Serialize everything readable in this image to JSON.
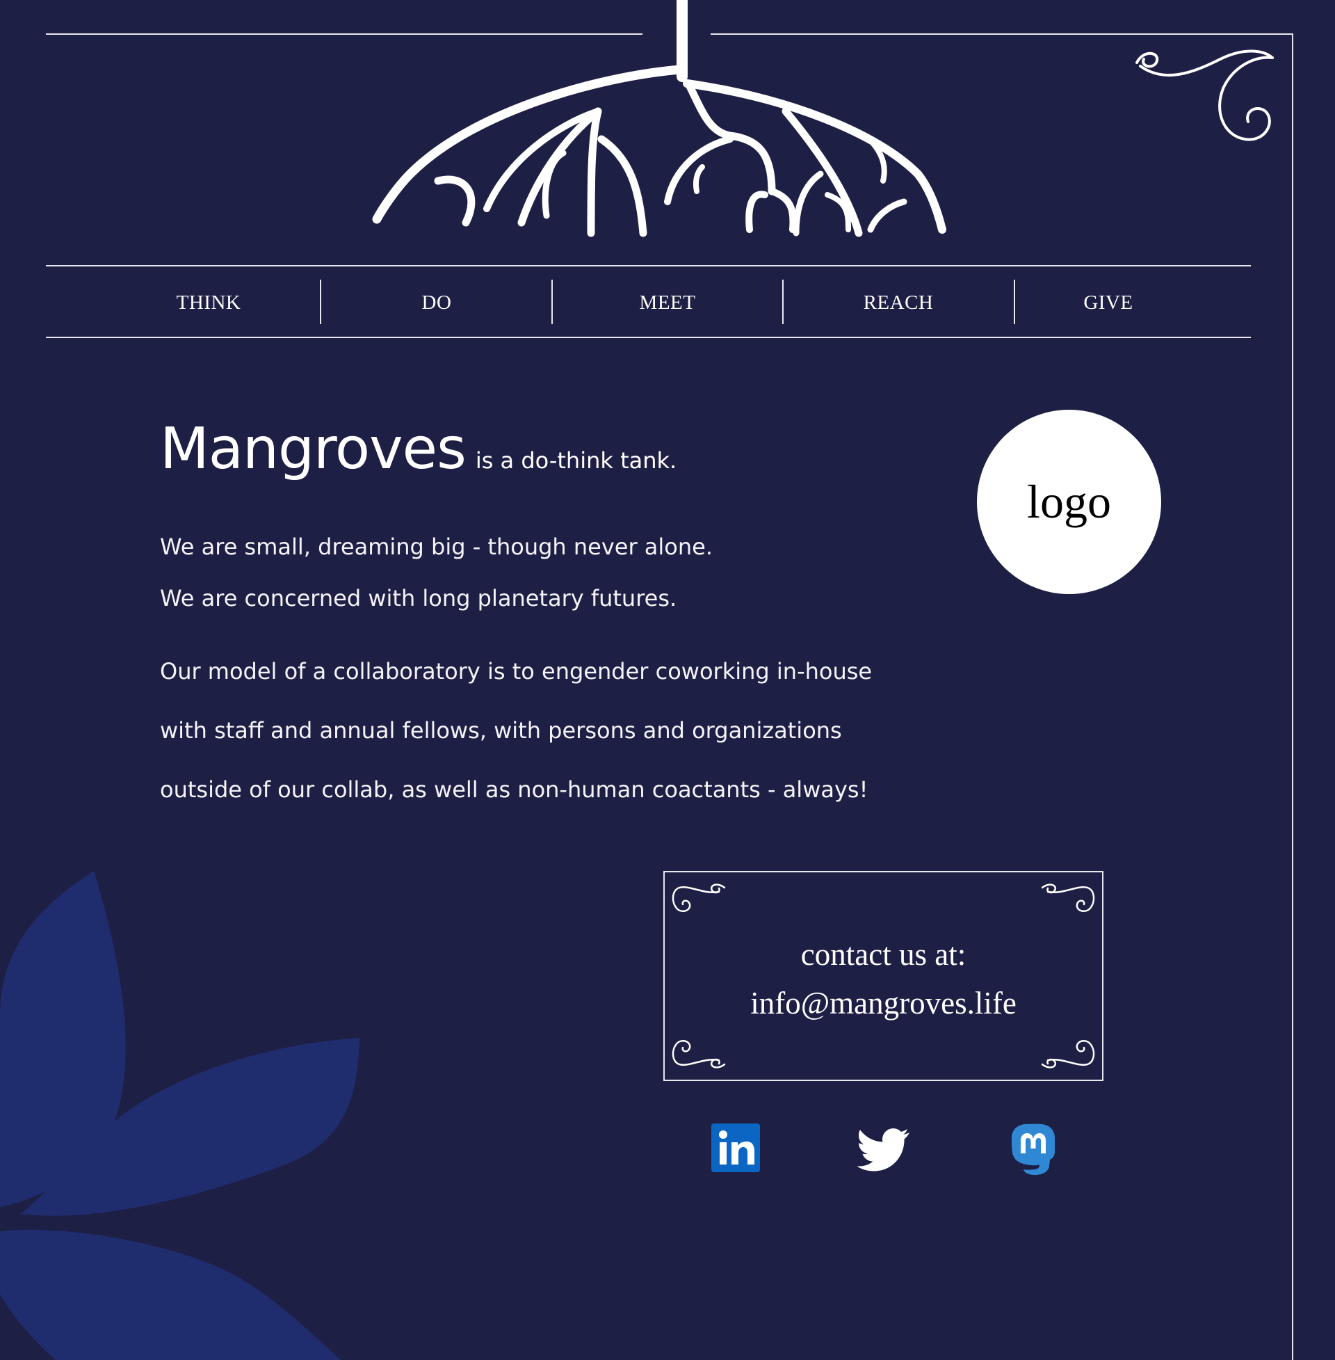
{
  "nav": {
    "items": [
      {
        "label": "THINK"
      },
      {
        "label": "DO"
      },
      {
        "label": "MEET"
      },
      {
        "label": "REACH"
      },
      {
        "label": "GIVE"
      }
    ]
  },
  "intro": {
    "name": "Mangroves",
    "tagline": "is a do-think tank.",
    "line1": "We are small, dreaming big - though never alone.",
    "line2": "We are concerned with long planetary futures.",
    "model_lines": [
      "Our model of a collaboratory is to engender coworking in-house",
      "with staff and annual fellows, with persons and organizations",
      "outside of our collab, as well as non-human coactants - always!"
    ]
  },
  "logo": {
    "text": "logo"
  },
  "contact": {
    "heading": "contact us at:",
    "email": "info@mangroves.life"
  },
  "social": {
    "linkedin_icon": "linkedin-icon",
    "twitter_icon": "twitter-icon",
    "mastodon_icon": "mastodon-icon"
  },
  "colors": {
    "background": "#1e1f45",
    "leaf": "#1f2d6e",
    "linkedin": "#0a66c2",
    "mastodon": "#3088d4"
  }
}
